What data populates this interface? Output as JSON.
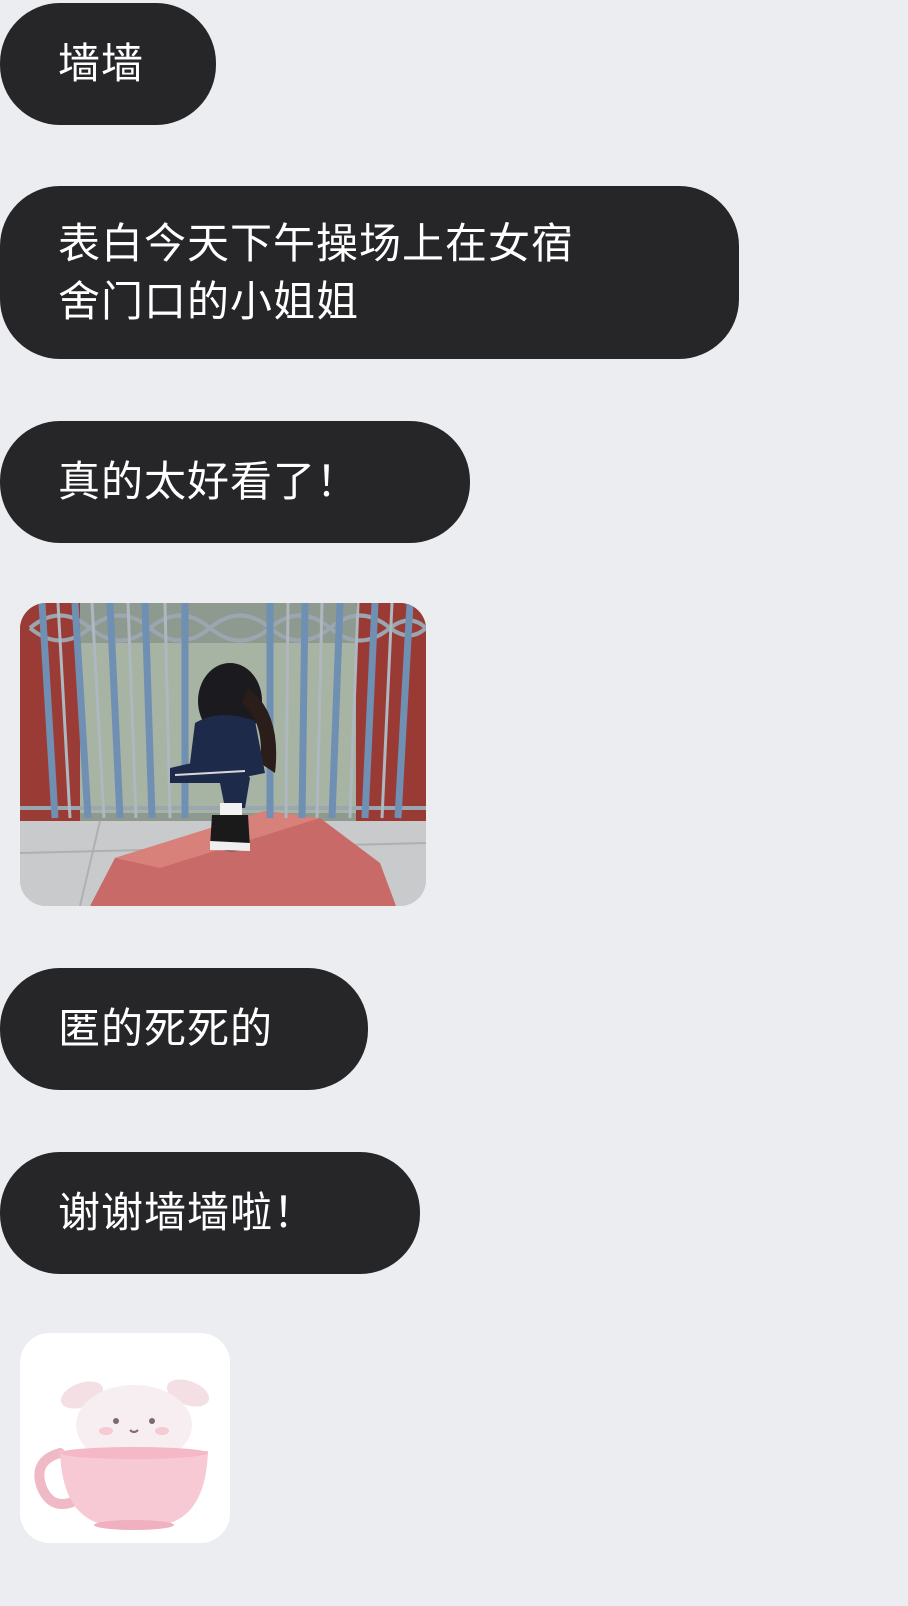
{
  "messages": [
    {
      "type": "text",
      "text": "墙墙"
    },
    {
      "type": "text",
      "text": "表白今天下午操场上在女宿\n舍门口的小姐姐"
    },
    {
      "type": "text",
      "text": "真的太好看了！"
    },
    {
      "type": "image",
      "icon": "photo-girl-at-gate"
    },
    {
      "type": "text",
      "text": "匿的死死的"
    },
    {
      "type": "text",
      "text": "谢谢墙墙啦！"
    },
    {
      "type": "sticker",
      "icon": "pink-puppy-in-cup-sticker"
    }
  ],
  "colors": {
    "background": "#ebedf1",
    "bubble": "#262628",
    "bubble_text": "#ffffff"
  }
}
